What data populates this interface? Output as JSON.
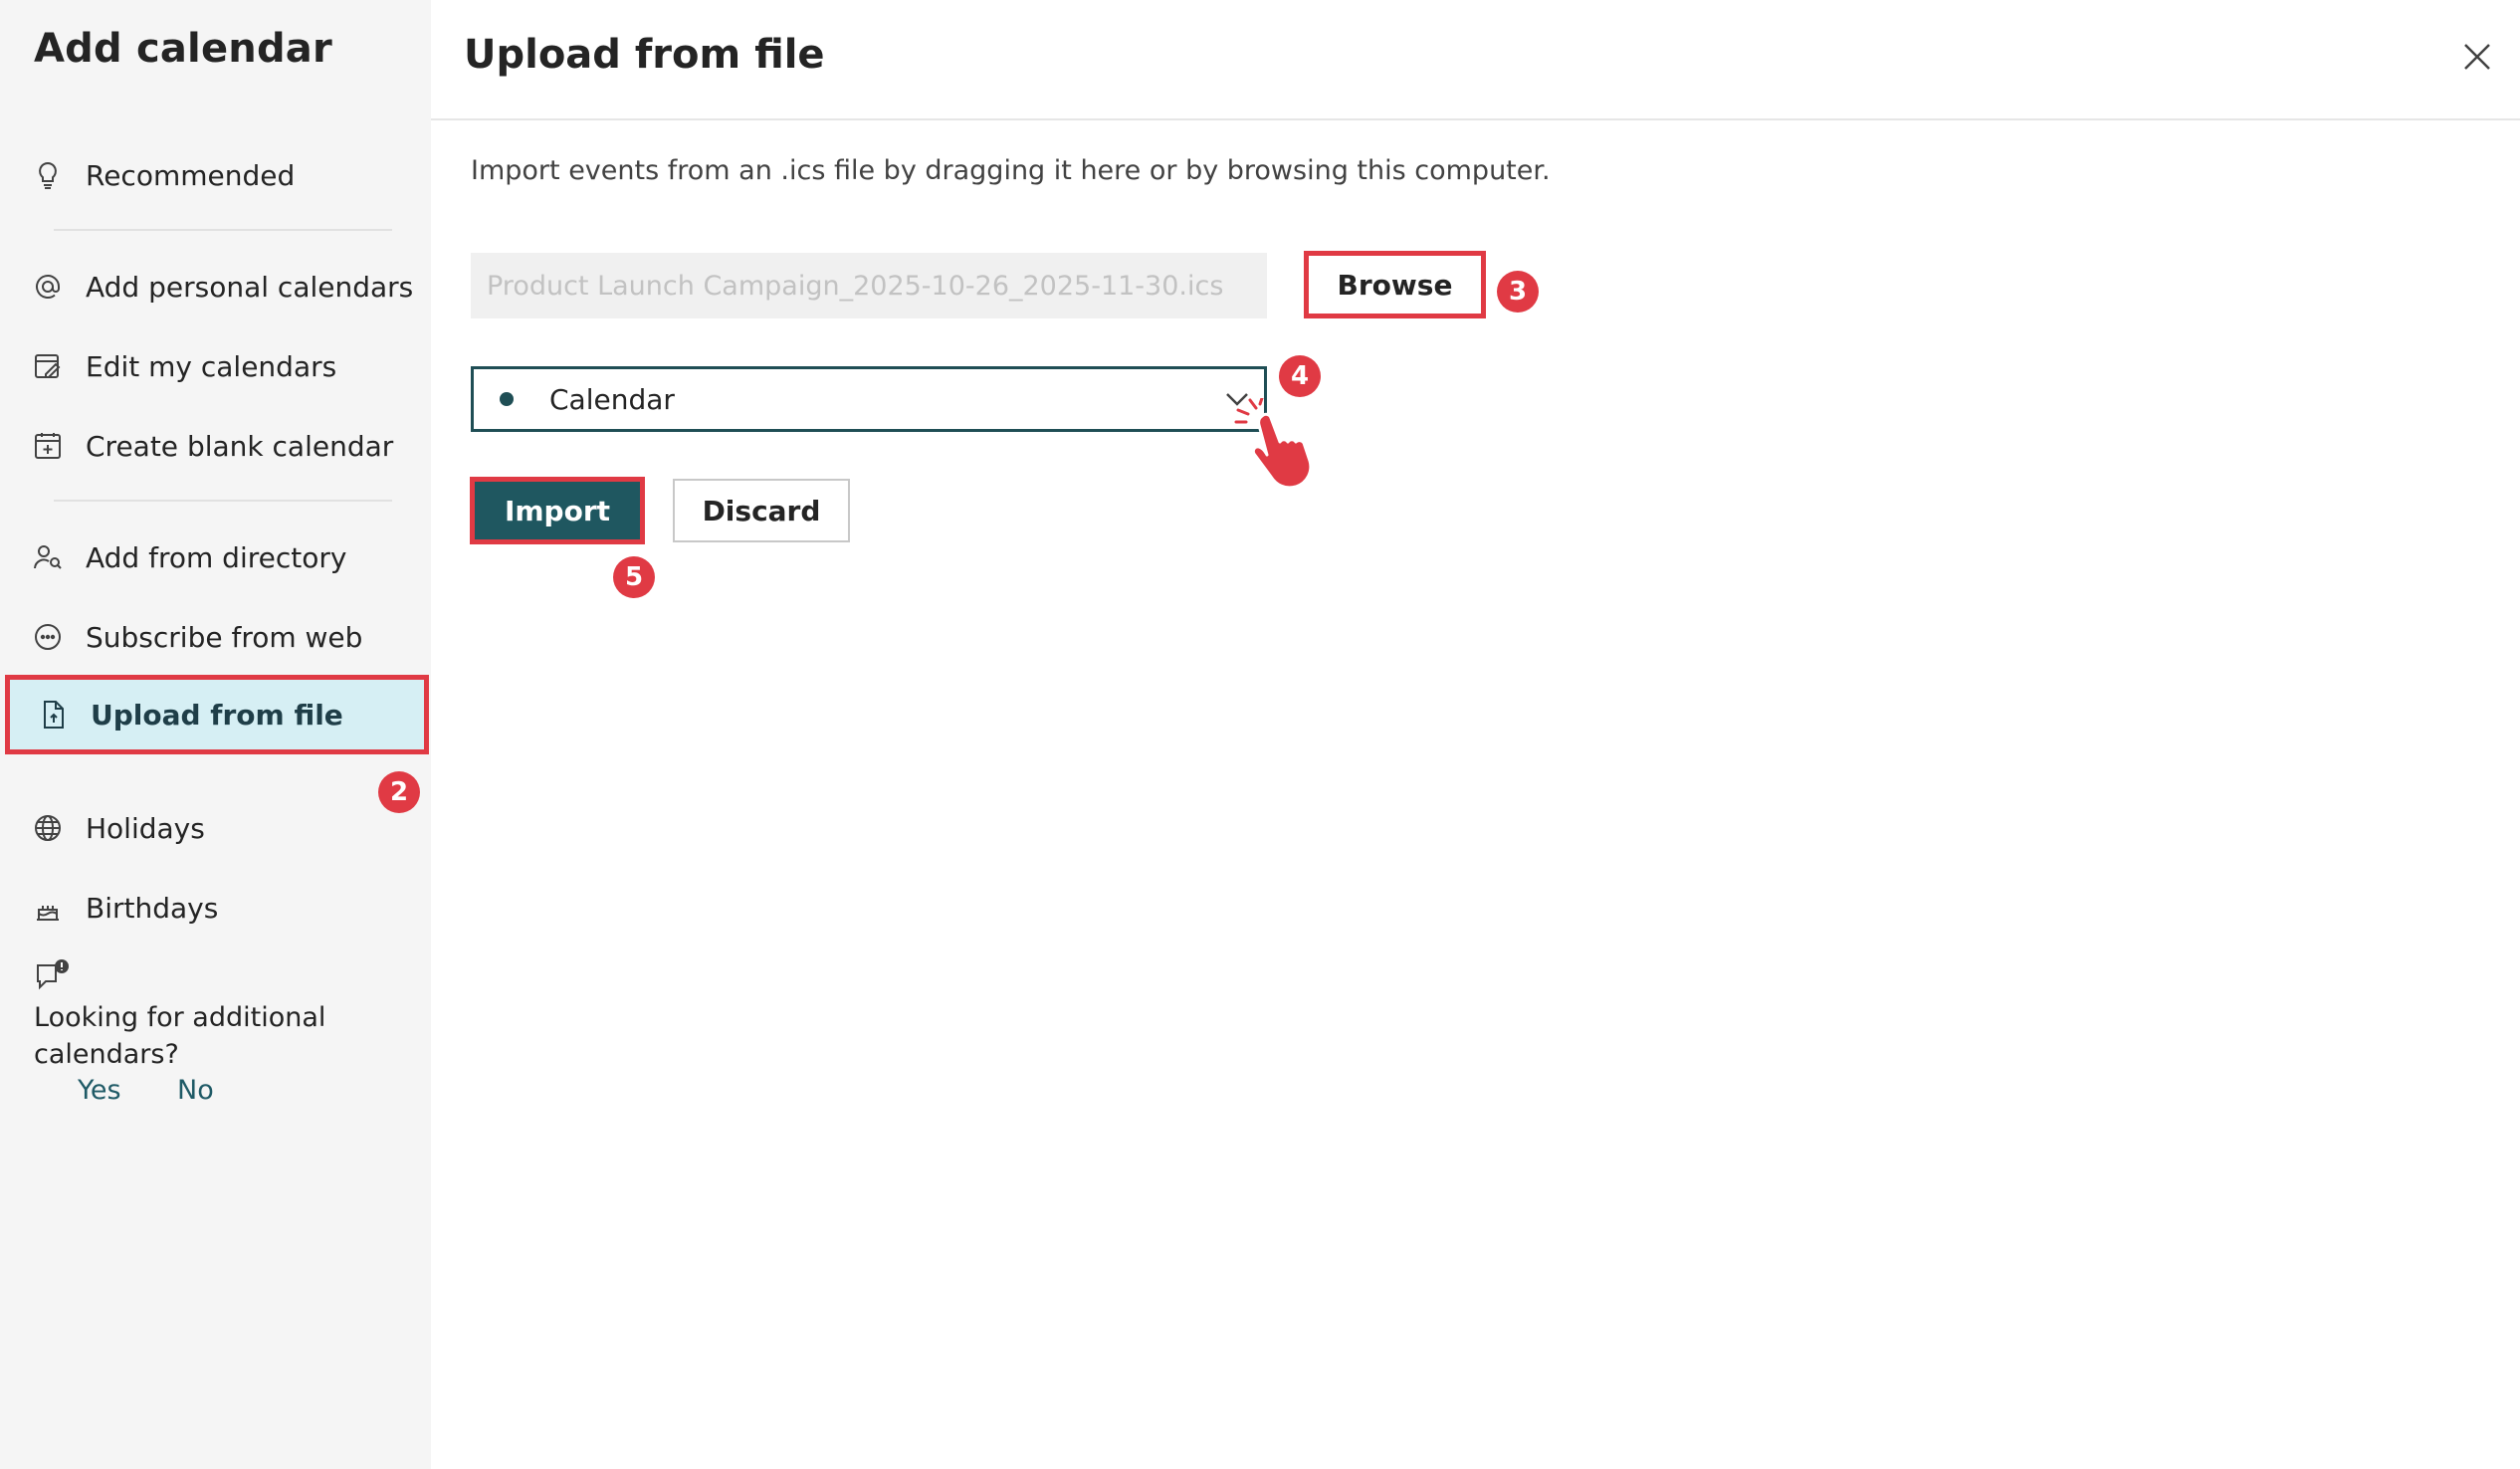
{
  "sidebar": {
    "title": "Add calendar",
    "items": [
      {
        "label": "Recommended",
        "icon": "lightbulb-icon"
      },
      {
        "label": "Add personal calendars",
        "icon": "at-sign-icon"
      },
      {
        "label": "Edit my calendars",
        "icon": "edit-calendar-icon"
      },
      {
        "label": "Create blank calendar",
        "icon": "calendar-add-icon"
      },
      {
        "label": "Add from directory",
        "icon": "people-search-icon"
      },
      {
        "label": "Subscribe from web",
        "icon": "web-link-icon"
      },
      {
        "label": "Upload from file",
        "icon": "document-arrow-icon",
        "selected": true
      },
      {
        "label": "Holidays",
        "icon": "globe-icon"
      },
      {
        "label": "Birthdays",
        "icon": "cake-icon"
      }
    ],
    "feedback": {
      "question": "Looking for additional calendars?",
      "yes": "Yes",
      "no": "No",
      "icon": "chat-alert-icon"
    }
  },
  "main": {
    "title": "Upload from file",
    "instructions": "Import events from an .ics file by dragging it here or by browsing this computer.",
    "file_field_value": "Product Launch Campaign_2025-10-26_2025-11-30.ics",
    "browse_label": "Browse",
    "calendar_select": "Calendar",
    "import_label": "Import",
    "discard_label": "Discard"
  },
  "steps": {
    "upload_step": "2",
    "browse_step": "3",
    "select_step": "4",
    "import_step": "5"
  },
  "colors": {
    "accent": "#1f5760",
    "highlight": "#e03a44",
    "selected_bg": "#d6eff4",
    "sidebar_bg": "#f5f5f5"
  }
}
